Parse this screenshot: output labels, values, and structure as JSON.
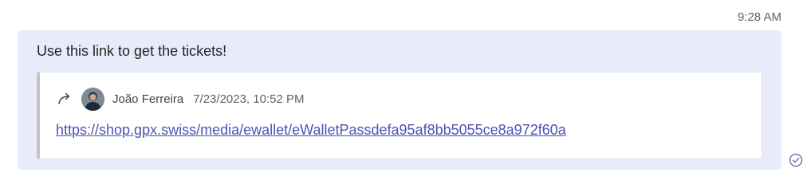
{
  "message": {
    "timestamp": "9:28 AM",
    "text": "Use this link to get the tickets!",
    "forwarded": {
      "author": "João Ferreira",
      "original_time": "7/23/2023, 10:52 PM",
      "link_text": "https://shop.gpx.swiss/media/ewallet/eWalletPassdefa95af8bb5055ce8a972f60a"
    },
    "status_icon": "sent-check-icon",
    "forward_icon": "forward-arrow-icon",
    "avatar_icon": "user-avatar"
  },
  "colors": {
    "bubble_background": "#e8ebfa",
    "link": "#4f52b2",
    "accent": "#6264a7"
  }
}
